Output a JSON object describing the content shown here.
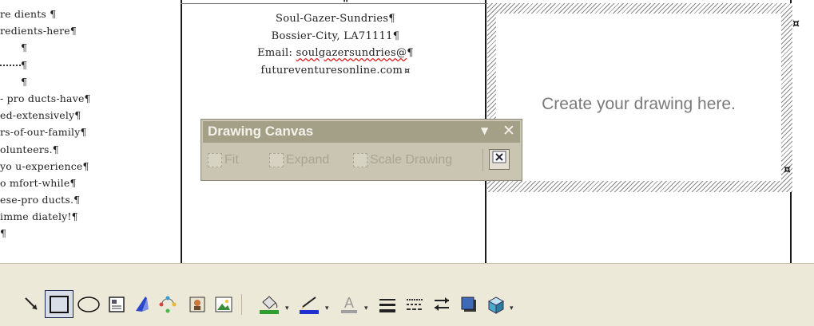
{
  "document": {
    "top_mark": "\"",
    "left_column": [
      "re dients ¶",
      "redients-here¶",
      "¶",
      "¶",
      "¶",
      "- pro ducts-have¶",
      "ed-extensively¶",
      "rs-of-our-family¶",
      "olunteers.¶",
      "yo u-experience¶",
      "o mfort-while¶",
      "ese-pro ducts.¶",
      "imme diately!¶",
      "¶"
    ],
    "middle_column": {
      "line1": "Soul-Gazer-Sundries¶",
      "line2": "Bossier-City, LA71111¶",
      "line3_prefix": "Email: ",
      "line3_link": "soulgazersundries@",
      "line3_suffix": "¶",
      "line4": "futureventuresonline.com",
      "cell_mark": "¤"
    }
  },
  "drawing_canvas": {
    "placeholder": "Create your drawing here.",
    "handle_glyph": "¤"
  },
  "canvas_toolbar": {
    "title": "Drawing Canvas",
    "menu_glyph": "▼",
    "close_glyph": "✕",
    "buttons": {
      "fit": "Fit",
      "expand": "Expand",
      "scale": "Scale Drawing"
    }
  },
  "drawing_toolbar": {
    "dropdown_glyph": "▾",
    "colors": {
      "fill": "#2e9e2e",
      "line": "#1f2fd0",
      "font": "#a0a0a0",
      "shadow": "#3e6ab8",
      "three_d": "#4fa7c9"
    }
  }
}
